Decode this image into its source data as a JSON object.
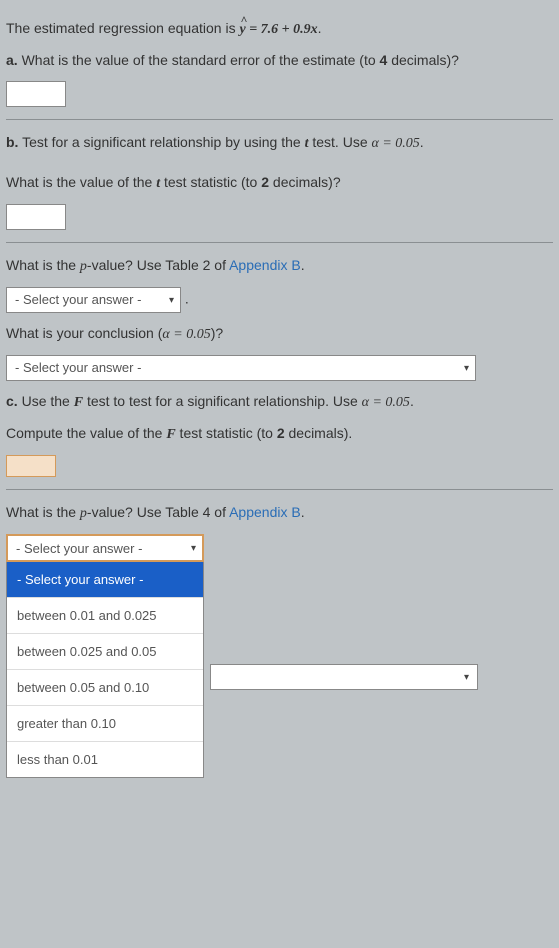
{
  "intro": {
    "prefix": "The estimated regression equation is ",
    "equation_lhs": "ŷ",
    "equation_eq": " = 7.6 + 0.9",
    "equation_x": "x",
    "period": "."
  },
  "partA": {
    "label": "a.",
    "text": " What is the value of the standard error of the estimate (to ",
    "four": "4",
    "text2": " decimals)?"
  },
  "partB": {
    "label": "b.",
    "text": " Test for a significant relationship by using the ",
    "t": "t",
    "text2": " test. Use ",
    "alpha": "α = 0.05",
    "period": "."
  },
  "tstat_q": {
    "pre": "What is the value of the ",
    "t": "t",
    "post": " test statistic (to ",
    "two": "2",
    "post2": " decimals)?"
  },
  "pval_b": {
    "pre": "What is the ",
    "p": "p",
    "mid": "-value? Use Table 2 of ",
    "appendix": "Appendix B",
    "period": "."
  },
  "select_placeholder": "- Select your answer -",
  "conclusion_q": {
    "pre": "What is your conclusion (",
    "alpha": "α = 0.05",
    "post": ")?"
  },
  "partC": {
    "label": "c.",
    "text": " Use the ",
    "F": "F",
    "text2": " test to test for a significant relationship. Use ",
    "alpha": "α = 0.05",
    "period": "."
  },
  "fstat_q": {
    "pre": "Compute the value of the ",
    "F": "F",
    "post": " test statistic (to ",
    "two": "2",
    "post2": " decimals)."
  },
  "pval_c": {
    "pre": "What is the ",
    "p": "p",
    "mid": "-value? Use Table 4 of ",
    "appendix": "Appendix B",
    "period": "."
  },
  "dropdown": {
    "selected": "- Select your answer -",
    "options": [
      "- Select your answer -",
      "between 0.01 and 0.025",
      "between 0.025 and 0.05",
      "between 0.05 and 0.10",
      "greater than 0.10",
      "less than 0.01"
    ]
  }
}
